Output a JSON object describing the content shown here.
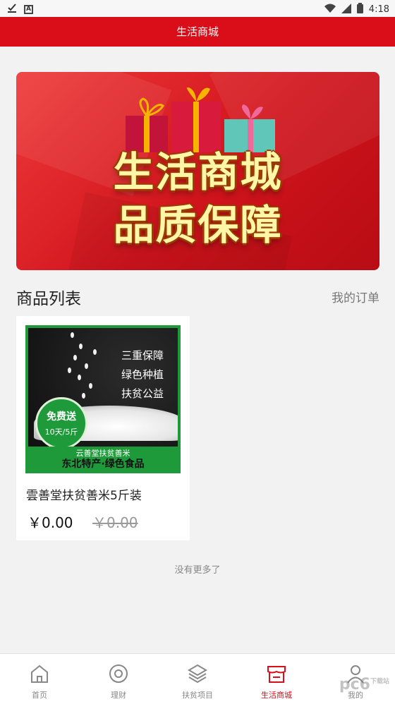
{
  "status_bar": {
    "time": "4:18",
    "left_icons": [
      "download-done-icon",
      "app-a-icon"
    ],
    "right_icons": [
      "wifi-icon",
      "signal-icon",
      "battery-icon"
    ]
  },
  "app_bar": {
    "title": "生活商城"
  },
  "banner": {
    "line1": "生活商城",
    "line2": "品质保障"
  },
  "section": {
    "title": "商品列表",
    "my_orders": "我的订单"
  },
  "products": [
    {
      "name": "雲善堂扶贫善米5斤装",
      "price": "￥0.00",
      "original_price": "￥0.00",
      "image": {
        "lines": [
          "三重保障",
          "绿色种植",
          "扶贫公益"
        ],
        "badge_main": "免费送",
        "badge_sub": "10天/5斤",
        "footer_top": "云善堂扶贫善米",
        "footer_bottom": "东北特产·绿色食品"
      }
    }
  ],
  "list_end_text": "没有更多了",
  "tabs": [
    {
      "label": "首页",
      "icon": "home-icon",
      "active": false
    },
    {
      "label": "理财",
      "icon": "target-icon",
      "active": false
    },
    {
      "label": "扶贫项目",
      "icon": "layers-icon",
      "active": false
    },
    {
      "label": "生活商城",
      "icon": "store-icon",
      "active": true
    },
    {
      "label": "我的",
      "icon": "person-icon",
      "active": false
    }
  ],
  "watermark": {
    "text": "pc6",
    "sub": "下载站"
  },
  "colors": {
    "brand_red": "#d90e18",
    "badge_green": "#1e9a3a",
    "banner_text": "#fff6a8"
  }
}
